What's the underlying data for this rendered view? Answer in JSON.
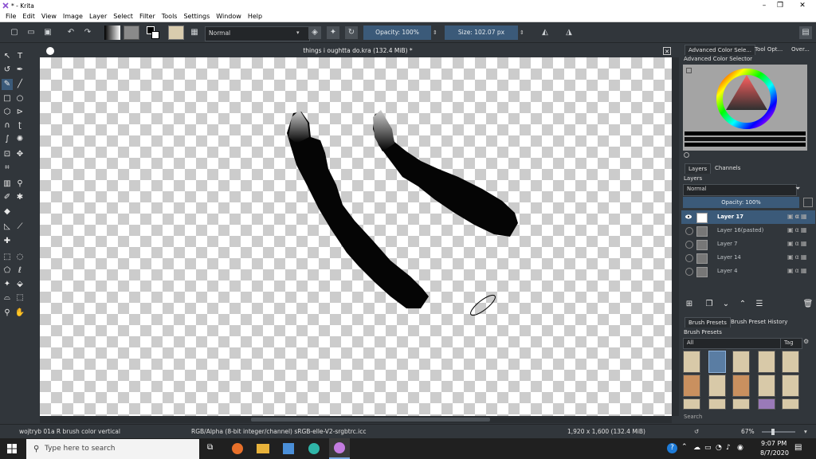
{
  "window": {
    "title": "* - Krita",
    "controls": {
      "minimize": "–",
      "maximize": "❐",
      "close": "✕"
    }
  },
  "menu": [
    "File",
    "Edit",
    "View",
    "Image",
    "Layer",
    "Select",
    "Filter",
    "Tools",
    "Settings",
    "Window",
    "Help"
  ],
  "toolbar": {
    "blend_mode": "Normal",
    "opacity_label": "Opacity: 100%",
    "size_label": "Size: 102.07 px"
  },
  "document": {
    "tab_title": "things i oughtta do.kra (132.4 MiB) *"
  },
  "docker": {
    "color_tabs": [
      "Advanced Color Sele...",
      "Tool Opt...",
      "Over..."
    ],
    "color_header": "Advanced Color Selector",
    "layers_tabs": [
      "Layers",
      "Channels"
    ],
    "layers_header": "Layers",
    "layers_blend": "Normal",
    "layers_opacity": "Opacity:  100%",
    "layers": [
      {
        "name": "Layer 17",
        "selected": true
      },
      {
        "name": "Layer 16(pasted)",
        "selected": false
      },
      {
        "name": "Layer 7",
        "selected": false
      },
      {
        "name": "Layer 14",
        "selected": false
      },
      {
        "name": "Layer 4",
        "selected": false
      }
    ],
    "brush_tabs": [
      "Brush Presets",
      "Brush Preset History"
    ],
    "brush_header": "Brush Presets",
    "brush_filter": "All",
    "brush_tag": "Tag",
    "search_placeholder": "Search"
  },
  "statusbar": {
    "brush_name": "wojtryb 01a R brush color vertical",
    "color_space": "RGB/Alpha (8-bit integer/channel)  sRGB-elle-V2-srgbtrc.icc",
    "dimensions": "1,920 x 1,600 (132.4 MiB)",
    "zoom": "67%"
  },
  "taskbar": {
    "search_placeholder": "Type here to search",
    "time": "9:07 PM",
    "date": "8/7/2020"
  },
  "colors": {
    "panel_bg": "#31363b",
    "selection": "#3b5a79",
    "taskbar": "#202020"
  }
}
